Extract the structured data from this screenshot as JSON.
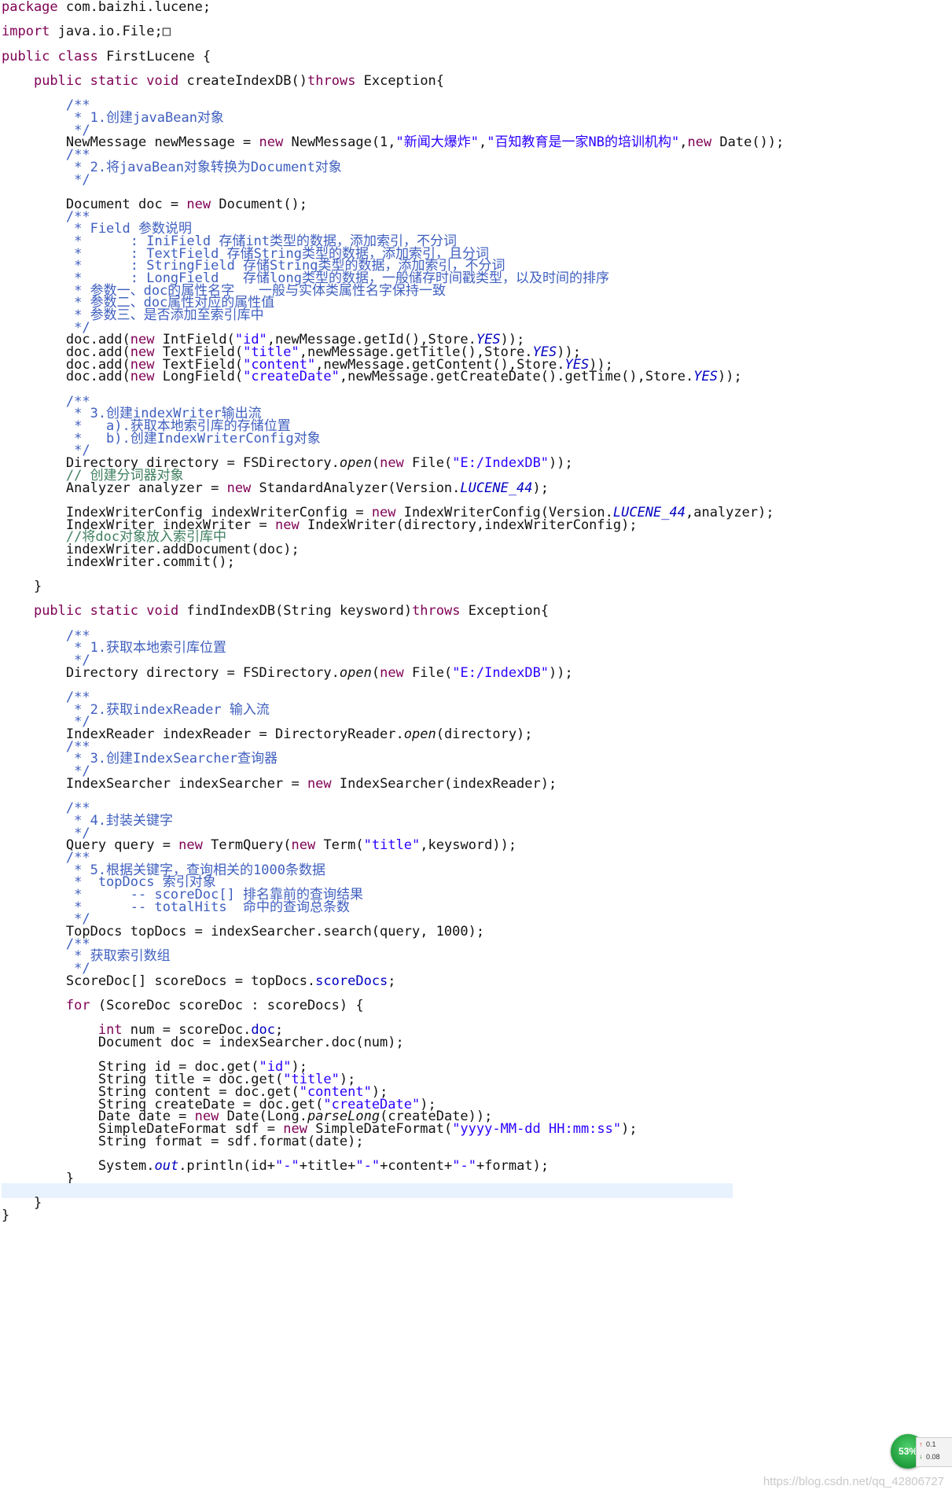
{
  "code": {
    "lines": [
      [
        [
          "kw",
          "package"
        ],
        [
          "plain",
          " com.baizhi.lucene;"
        ]
      ],
      [],
      [
        [
          "kw",
          "import"
        ],
        [
          "plain",
          " java.io.File;□"
        ]
      ],
      [],
      [
        [
          "kw",
          "public"
        ],
        [
          "plain",
          " "
        ],
        [
          "kw",
          "class"
        ],
        [
          "plain",
          " FirstLucene {"
        ]
      ],
      [],
      [
        [
          "plain",
          "    "
        ],
        [
          "kw",
          "public"
        ],
        [
          "plain",
          " "
        ],
        [
          "kw",
          "static"
        ],
        [
          "plain",
          " "
        ],
        [
          "kw",
          "void"
        ],
        [
          "plain",
          " createIndexDB()"
        ],
        [
          "kw",
          "throws"
        ],
        [
          "plain",
          " Exception{"
        ]
      ],
      [],
      [
        [
          "cm",
          "        /**"
        ]
      ],
      [
        [
          "cm",
          "         * 1.创建javaBean对象"
        ]
      ],
      [
        [
          "cm",
          "         */"
        ]
      ],
      [
        [
          "plain",
          "        NewMessage newMessage = "
        ],
        [
          "kw",
          "new"
        ],
        [
          "plain",
          " NewMessage(1,"
        ],
        [
          "str",
          "\"新闻大爆炸\""
        ],
        [
          "plain",
          ","
        ],
        [
          "str",
          "\"百知教育是一家NB的培训机构\""
        ],
        [
          "plain",
          ","
        ],
        [
          "kw",
          "new"
        ],
        [
          "plain",
          " Date());"
        ]
      ],
      [
        [
          "cm",
          "        /**"
        ]
      ],
      [
        [
          "cm",
          "         * 2.将javaBean对象转换为Document对象"
        ]
      ],
      [
        [
          "cm",
          "         */"
        ]
      ],
      [],
      [
        [
          "plain",
          "        Document doc = "
        ],
        [
          "kw",
          "new"
        ],
        [
          "plain",
          " Document();"
        ]
      ],
      [
        [
          "cm",
          "        /**"
        ]
      ],
      [
        [
          "cm",
          "         * Field 参数说明"
        ]
      ],
      [
        [
          "cm",
          "         *      : IniField 存储int类型的数据，添加索引，不分词"
        ]
      ],
      [
        [
          "cm",
          "         *      : TextField 存储String类型的数据，添加索引，且分词"
        ]
      ],
      [
        [
          "cm",
          "         *      : StringField 存储String类型的数据，添加索引，不分词"
        ]
      ],
      [
        [
          "cm",
          "         *      : LongField   存储long类型的数据，一般储存时间戳类型，以及时间的排序"
        ]
      ],
      [
        [
          "cm",
          "         * 参数一、doc的属性名字   一般与实体类属性名字保持一致"
        ]
      ],
      [
        [
          "cm",
          "         * 参数二、doc属性对应的属性值"
        ]
      ],
      [
        [
          "cm",
          "         * 参数三、是否添加至索引库中"
        ]
      ],
      [
        [
          "cm",
          "         */"
        ]
      ],
      [
        [
          "plain",
          "        doc.add("
        ],
        [
          "kw",
          "new"
        ],
        [
          "plain",
          " IntField("
        ],
        [
          "str",
          "\"id\""
        ],
        [
          "plain",
          ",newMessage.getId(),Store."
        ],
        [
          "fld it",
          "YES"
        ],
        [
          "plain",
          "));"
        ]
      ],
      [
        [
          "plain",
          "        doc.add("
        ],
        [
          "kw",
          "new"
        ],
        [
          "plain",
          " TextField("
        ],
        [
          "str",
          "\"title\""
        ],
        [
          "plain",
          ",newMessage.getTitle(),Store."
        ],
        [
          "fld it",
          "YES"
        ],
        [
          "plain",
          "));"
        ]
      ],
      [
        [
          "plain",
          "        doc.add("
        ],
        [
          "kw",
          "new"
        ],
        [
          "plain",
          " TextField("
        ],
        [
          "str",
          "\"content\""
        ],
        [
          "plain",
          ",newMessage.getContent(),Store."
        ],
        [
          "fld it",
          "YES"
        ],
        [
          "plain",
          "));"
        ]
      ],
      [
        [
          "plain",
          "        doc.add("
        ],
        [
          "kw",
          "new"
        ],
        [
          "plain",
          " LongField("
        ],
        [
          "str",
          "\"createDate\""
        ],
        [
          "plain",
          ",newMessage.getCreateDate().getTime(),Store."
        ],
        [
          "fld it",
          "YES"
        ],
        [
          "plain",
          "));"
        ]
      ],
      [],
      [
        [
          "cm",
          "        /**"
        ]
      ],
      [
        [
          "cm",
          "         * 3.创建indexWriter输出流"
        ]
      ],
      [
        [
          "cm",
          "         *   a).获取本地索引库的存储位置"
        ]
      ],
      [
        [
          "cm",
          "         *   b).创建IndexWriterConfig对象"
        ]
      ],
      [
        [
          "cm",
          "         */"
        ]
      ],
      [
        [
          "plain",
          "        Directory directory = FSDirectory."
        ],
        [
          "static",
          "open"
        ],
        [
          "plain",
          "("
        ],
        [
          "kw",
          "new"
        ],
        [
          "plain",
          " File("
        ],
        [
          "str",
          "\"E:/IndexDB\""
        ],
        [
          "plain",
          "));"
        ]
      ],
      [
        [
          "lc",
          "        // 创建分词器对象"
        ]
      ],
      [
        [
          "plain",
          "        Analyzer analyzer = "
        ],
        [
          "kw",
          "new"
        ],
        [
          "plain",
          " StandardAnalyzer(Version."
        ],
        [
          "fld it",
          "LUCENE_44"
        ],
        [
          "plain",
          ");"
        ]
      ],
      [],
      [
        [
          "plain",
          "        IndexWriterConfig indexWriterConfig = "
        ],
        [
          "kw",
          "new"
        ],
        [
          "plain",
          " IndexWriterConfig(Version."
        ],
        [
          "fld it",
          "LUCENE_44"
        ],
        [
          "plain",
          ",analyzer);"
        ]
      ],
      [
        [
          "plain",
          "        IndexWriter indexWriter = "
        ],
        [
          "kw",
          "new"
        ],
        [
          "plain",
          " IndexWriter(directory,indexWriterConfig);"
        ]
      ],
      [
        [
          "lc",
          "        //将doc对象放入索引库中"
        ]
      ],
      [
        [
          "plain",
          "        indexWriter.addDocument(doc);"
        ]
      ],
      [
        [
          "plain",
          "        indexWriter.commit();"
        ]
      ],
      [],
      [
        [
          "plain",
          "    }"
        ]
      ],
      [],
      [
        [
          "plain",
          "    "
        ],
        [
          "kw",
          "public"
        ],
        [
          "plain",
          " "
        ],
        [
          "kw",
          "static"
        ],
        [
          "plain",
          " "
        ],
        [
          "kw",
          "void"
        ],
        [
          "plain",
          " findIndexDB(String keysword)"
        ],
        [
          "kw",
          "throws"
        ],
        [
          "plain",
          " Exception{"
        ]
      ],
      [],
      [
        [
          "cm",
          "        /**"
        ]
      ],
      [
        [
          "cm",
          "         * 1.获取本地索引库位置"
        ]
      ],
      [
        [
          "cm",
          "         */"
        ]
      ],
      [
        [
          "plain",
          "        Directory directory = FSDirectory."
        ],
        [
          "static",
          "open"
        ],
        [
          "plain",
          "("
        ],
        [
          "kw",
          "new"
        ],
        [
          "plain",
          " File("
        ],
        [
          "str",
          "\"E:/IndexDB\""
        ],
        [
          "plain",
          "));"
        ]
      ],
      [],
      [
        [
          "cm",
          "        /**"
        ]
      ],
      [
        [
          "cm",
          "         * 2.获取indexReader 输入流"
        ]
      ],
      [
        [
          "cm",
          "         */"
        ]
      ],
      [
        [
          "plain",
          "        IndexReader indexReader = DirectoryReader."
        ],
        [
          "static",
          "open"
        ],
        [
          "plain",
          "(directory);"
        ]
      ],
      [
        [
          "cm",
          "        /**"
        ]
      ],
      [
        [
          "cm",
          "         * 3.创建IndexSearcher查询器"
        ]
      ],
      [
        [
          "cm",
          "         */"
        ]
      ],
      [
        [
          "plain",
          "        IndexSearcher indexSearcher = "
        ],
        [
          "kw",
          "new"
        ],
        [
          "plain",
          " IndexSearcher(indexReader);"
        ]
      ],
      [],
      [
        [
          "cm",
          "        /**"
        ]
      ],
      [
        [
          "cm",
          "         * 4.封装关键字"
        ]
      ],
      [
        [
          "cm",
          "         */"
        ]
      ],
      [
        [
          "plain",
          "        Query query = "
        ],
        [
          "kw",
          "new"
        ],
        [
          "plain",
          " TermQuery("
        ],
        [
          "kw",
          "new"
        ],
        [
          "plain",
          " Term("
        ],
        [
          "str",
          "\"title\""
        ],
        [
          "plain",
          ",keysword));"
        ]
      ],
      [
        [
          "cm",
          "        /**"
        ]
      ],
      [
        [
          "cm",
          "         * 5.根据关键字，查询相关的1000条数据"
        ]
      ],
      [
        [
          "cm",
          "         *  topDocs 索引对象"
        ]
      ],
      [
        [
          "cm",
          "         *      -- scoreDoc[] 排名靠前的查询结果"
        ]
      ],
      [
        [
          "cm",
          "         *      -- totalHits  命中的查询总条数"
        ]
      ],
      [
        [
          "cm",
          "         */"
        ]
      ],
      [
        [
          "plain",
          "        TopDocs topDocs = indexSearcher.search(query, 1000);"
        ]
      ],
      [
        [
          "cm",
          "        /**"
        ]
      ],
      [
        [
          "cm",
          "         * 获取索引数组"
        ]
      ],
      [
        [
          "cm",
          "         */"
        ]
      ],
      [
        [
          "plain",
          "        ScoreDoc[] scoreDocs = topDocs."
        ],
        [
          "fld",
          "scoreDocs"
        ],
        [
          "plain",
          ";"
        ]
      ],
      [],
      [
        [
          "plain",
          "        "
        ],
        [
          "kw",
          "for"
        ],
        [
          "plain",
          " (ScoreDoc scoreDoc : scoreDocs) {"
        ]
      ],
      [],
      [
        [
          "plain",
          "            "
        ],
        [
          "kw",
          "int"
        ],
        [
          "plain",
          " num = scoreDoc."
        ],
        [
          "fld",
          "doc"
        ],
        [
          "plain",
          ";"
        ]
      ],
      [
        [
          "plain",
          "            Document doc = indexSearcher.doc(num);"
        ]
      ],
      [],
      [
        [
          "plain",
          "            String id = doc.get("
        ],
        [
          "str",
          "\"id\""
        ],
        [
          "plain",
          ");"
        ]
      ],
      [
        [
          "plain",
          "            String title = doc.get("
        ],
        [
          "str",
          "\"title\""
        ],
        [
          "plain",
          ");"
        ]
      ],
      [
        [
          "plain",
          "            String content = doc.get("
        ],
        [
          "str",
          "\"content\""
        ],
        [
          "plain",
          ");"
        ]
      ],
      [
        [
          "plain",
          "            String createDate = doc.get("
        ],
        [
          "str",
          "\"createDate\""
        ],
        [
          "plain",
          ");"
        ]
      ],
      [
        [
          "plain",
          "            Date date = "
        ],
        [
          "kw",
          "new"
        ],
        [
          "plain",
          " Date(Long."
        ],
        [
          "static",
          "parseLong"
        ],
        [
          "plain",
          "(createDate));"
        ]
      ],
      [
        [
          "plain",
          "            SimpleDateFormat sdf = "
        ],
        [
          "kw",
          "new"
        ],
        [
          "plain",
          " SimpleDateFormat("
        ],
        [
          "str",
          "\"yyyy-MM-dd HH:mm:ss\""
        ],
        [
          "plain",
          ");"
        ]
      ],
      [
        [
          "plain",
          "            String format = sdf.format(date);"
        ]
      ],
      [],
      [
        [
          "plain",
          "            System."
        ],
        [
          "fld it",
          "out"
        ],
        [
          "plain",
          ".println(id+"
        ],
        [
          "str",
          "\"-\""
        ],
        [
          "plain",
          "+title+"
        ],
        [
          "str",
          "\"-\""
        ],
        [
          "plain",
          "+content+"
        ],
        [
          "str",
          "\"-\""
        ],
        [
          "plain",
          "+format);"
        ]
      ],
      [
        [
          "plain",
          "        }"
        ]
      ],
      [],
      [
        [
          "plain",
          "    }"
        ]
      ],
      [
        [
          "plain",
          "}"
        ]
      ]
    ],
    "highlight_line": 96
  },
  "widget": {
    "percent": "53%",
    "up_icon": "arrow-up-icon",
    "down_icon": "arrow-down-icon",
    "up_value": "0.1",
    "down_value": "0.08"
  },
  "watermark": "https://blog.csdn.net/qq_42806727"
}
